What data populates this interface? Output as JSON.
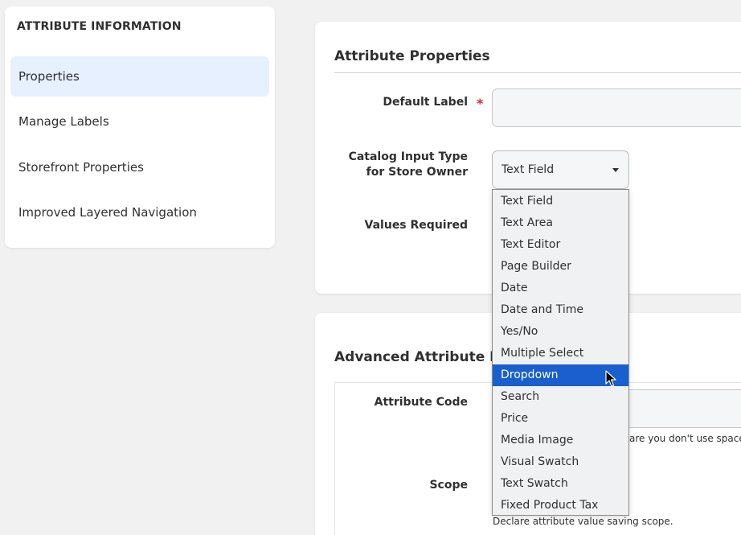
{
  "sidebar": {
    "title": "ATTRIBUTE INFORMATION",
    "items": [
      {
        "label": "Properties",
        "active": true
      },
      {
        "label": "Manage Labels",
        "active": false
      },
      {
        "label": "Storefront Properties",
        "active": false
      },
      {
        "label": "Improved Layered Navigation",
        "active": false
      }
    ]
  },
  "attribute_properties": {
    "title": "Attribute Properties",
    "default_label": {
      "label": "Default Label",
      "required_mark": "*",
      "value": ""
    },
    "catalog_input_type": {
      "label_line1": "Catalog Input Type",
      "label_line2": "for Store Owner",
      "selected": "Text Field",
      "options": [
        "Text Field",
        "Text Area",
        "Text Editor",
        "Page Builder",
        "Date",
        "Date and Time",
        "Yes/No",
        "Multiple Select",
        "Dropdown",
        "Search",
        "Price",
        "Media Image",
        "Visual Swatch",
        "Text Swatch",
        "Fixed Product Tax"
      ],
      "highlighted": "Dropdown"
    },
    "values_required": {
      "label": "Values Required"
    }
  },
  "advanced": {
    "title": "Advanced Attribute Pro",
    "attribute_code": {
      "label": "Attribute Code",
      "hint": "are you don't use spaces o"
    },
    "scope": {
      "label": "Scope",
      "hint": "Declare attribute value saving scope."
    }
  },
  "colors": {
    "accent": "#1a5fce",
    "active_nav": "#e6f0fe",
    "required": "#e22626"
  }
}
